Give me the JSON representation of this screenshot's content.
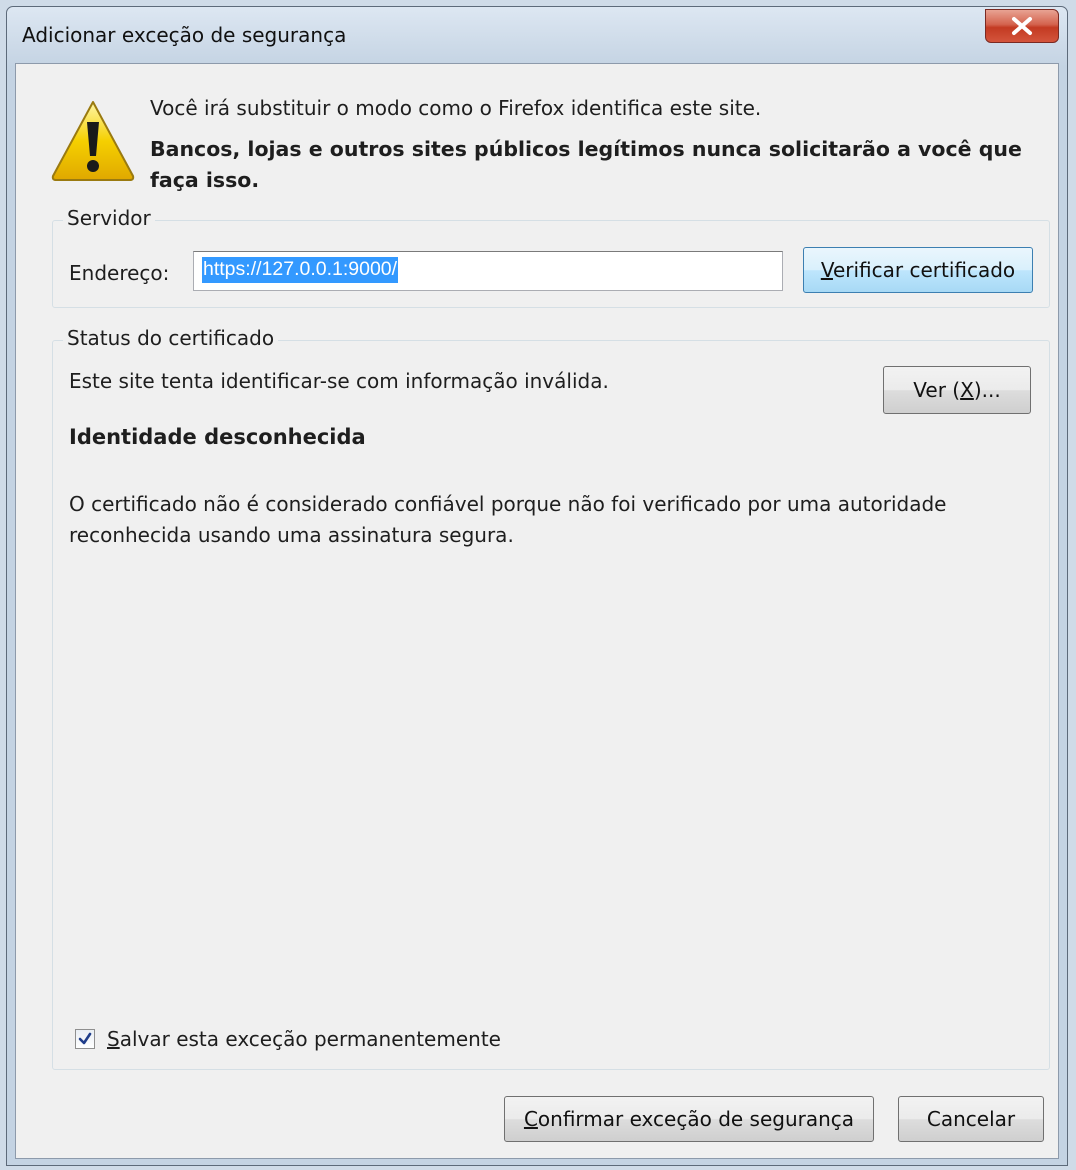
{
  "window": {
    "title": "Adicionar exceção de segurança",
    "close_icon": "close-x-icon"
  },
  "warning": {
    "icon": "warning-triangle-icon",
    "line1": "Você irá substituir o modo como o Firefox identifica este site.",
    "line2": "Bancos, lojas e outros sites públicos legítimos nunca solicitarão a você que faça isso."
  },
  "server": {
    "legend": "Servidor",
    "address_label": "Endereço:",
    "address_value": "https://127.0.0.1:9000/",
    "verify_button": {
      "accel": "V",
      "rest": "erificar certificado"
    }
  },
  "status": {
    "legend": "Status do certificado",
    "text": "Este site tenta identificar-se com informação inválida.",
    "view_button": {
      "pre": "Ver (",
      "accel": "X",
      "post": ")..."
    },
    "identity_heading": "Identidade desconhecida",
    "identity_description": "O certificado não é considerado confiável porque não foi verificado por uma autoridade reconhecida usando uma assinatura segura."
  },
  "save": {
    "checked": true,
    "accel": "S",
    "rest": "alvar esta exceção permanentemente"
  },
  "buttons": {
    "confirm": {
      "accel": "C",
      "rest": "onfirmar exceção de segurança"
    },
    "cancel": "Cancelar"
  },
  "colors": {
    "selection": "#3399ff",
    "dialog_bg": "#f0f0f0",
    "close_red": "#c33a22",
    "warning_yellow": "#f5d000"
  }
}
